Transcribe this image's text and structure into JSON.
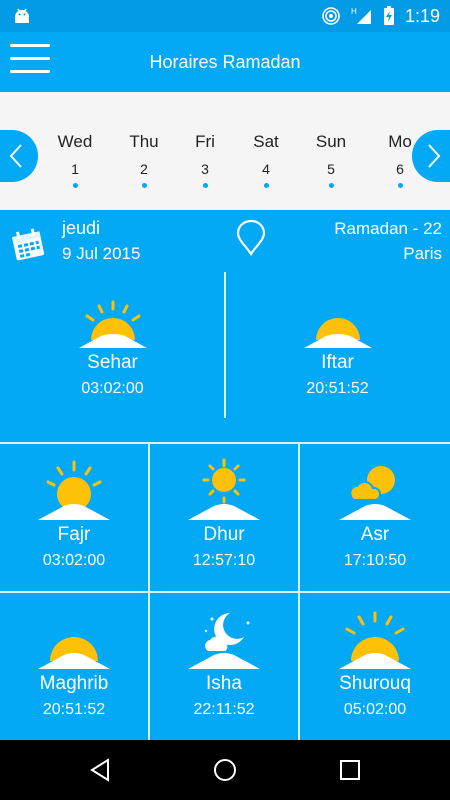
{
  "status": {
    "time": "1:19",
    "icons": [
      "android-icon",
      "hotspot-icon",
      "signal-icon",
      "battery-charging-icon"
    ],
    "network_label": "H"
  },
  "appbar": {
    "title": "Horaires Ramadan",
    "menu_icon": "hamburger-menu-icon"
  },
  "days": [
    {
      "name": "Wed",
      "num": "1"
    },
    {
      "name": "Thu",
      "num": "2"
    },
    {
      "name": "Fri",
      "num": "3"
    },
    {
      "name": "Sat",
      "num": "4"
    },
    {
      "name": "Sun",
      "num": "5"
    },
    {
      "name": "Mo",
      "num": "6"
    }
  ],
  "info": {
    "day_name": "jeudi",
    "date": "9 Jul 2015",
    "hijri": "Ramadan - 22",
    "city": "Paris"
  },
  "main": {
    "sehar": {
      "name": "Sehar",
      "time": "03:02:00",
      "icon": "sunrise-icon"
    },
    "iftar": {
      "name": "Iftar",
      "time": "20:51:52",
      "icon": "sunset-icon"
    }
  },
  "prayers": [
    {
      "name": "Fajr",
      "time": "03:02:00",
      "icon": "sunrise-icon"
    },
    {
      "name": "Dhur",
      "time": "12:57:10",
      "icon": "sun-high-icon"
    },
    {
      "name": "Asr",
      "time": "17:10:50",
      "icon": "sun-cloud-icon"
    },
    {
      "name": "Maghrib",
      "time": "20:51:52",
      "icon": "sunset-icon"
    },
    {
      "name": "Isha",
      "time": "22:11:52",
      "icon": "moon-icon"
    },
    {
      "name": "Shurouq",
      "time": "05:02:00",
      "icon": "sunrise-icon"
    }
  ],
  "colors": {
    "primary": "#03A9F4",
    "sun": "#FFC107",
    "strip_bg": "#F5F5F5"
  }
}
